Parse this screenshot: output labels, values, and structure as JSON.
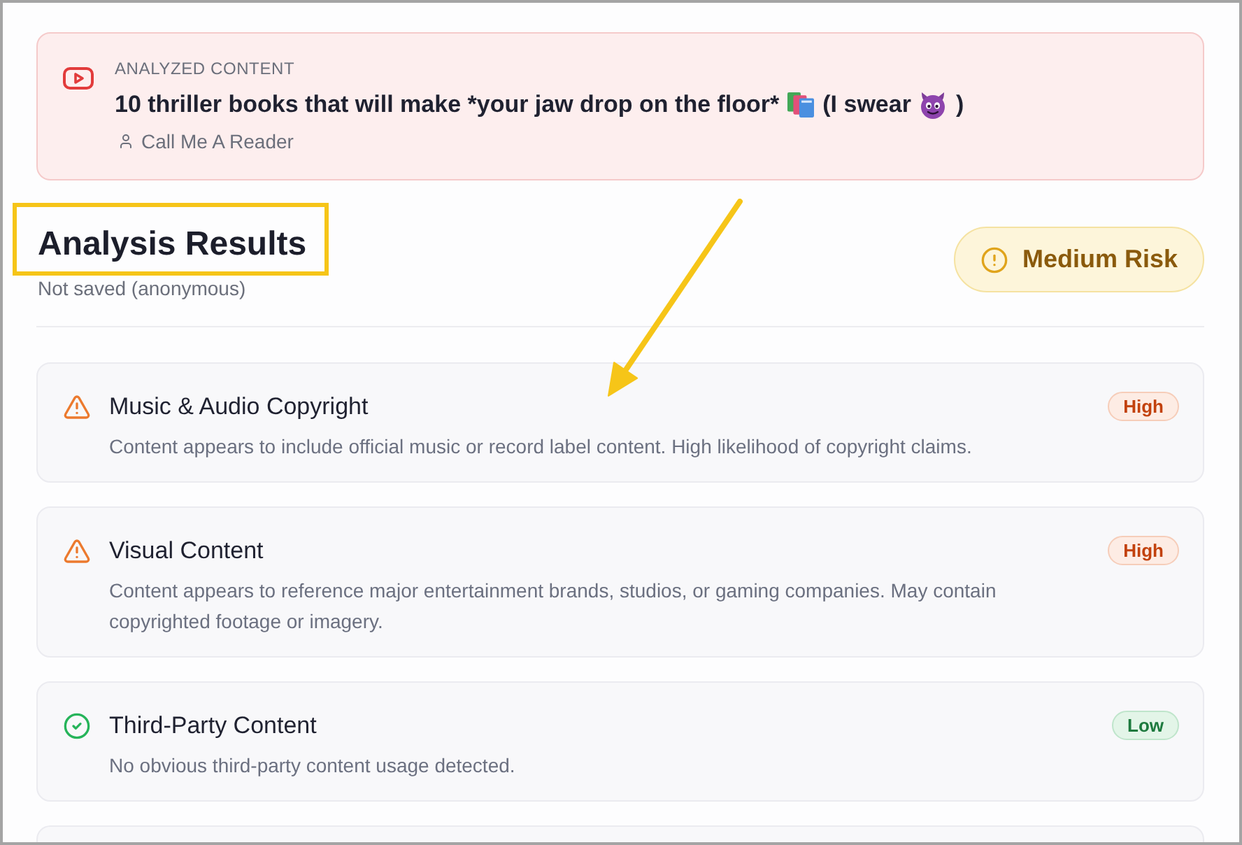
{
  "analyzed_content": {
    "label": "ANALYZED CONTENT",
    "title_parts": [
      {
        "kind": "text",
        "text": "10 thriller books that will make *your jaw drop on the floor*"
      },
      {
        "kind": "books"
      },
      {
        "kind": "text",
        "text": "(I swear"
      },
      {
        "kind": "devil"
      },
      {
        "kind": "text",
        "text": ")"
      }
    ],
    "author": "Call Me A Reader"
  },
  "results": {
    "title": "Analysis Results",
    "subtitle": "Not saved (anonymous)",
    "risk": {
      "kind": "medium",
      "label": "Medium Risk"
    }
  },
  "findings": [
    {
      "kind": "high",
      "title": "Music & Audio Copyright",
      "description": "Content appears to include official music or record label content. High likelihood of copyright claims.",
      "badge": "High"
    },
    {
      "kind": "high",
      "title": "Visual Content",
      "description": "Content appears to reference major entertainment brands, studios, or gaming companies. May contain copyrighted footage or imagery.",
      "badge": "High"
    },
    {
      "kind": "low",
      "title": "Third-Party Content",
      "description": "No obvious third-party content usage detected.",
      "badge": "Low"
    }
  ],
  "annotations": {
    "highlight_box": true,
    "arrow": true
  }
}
